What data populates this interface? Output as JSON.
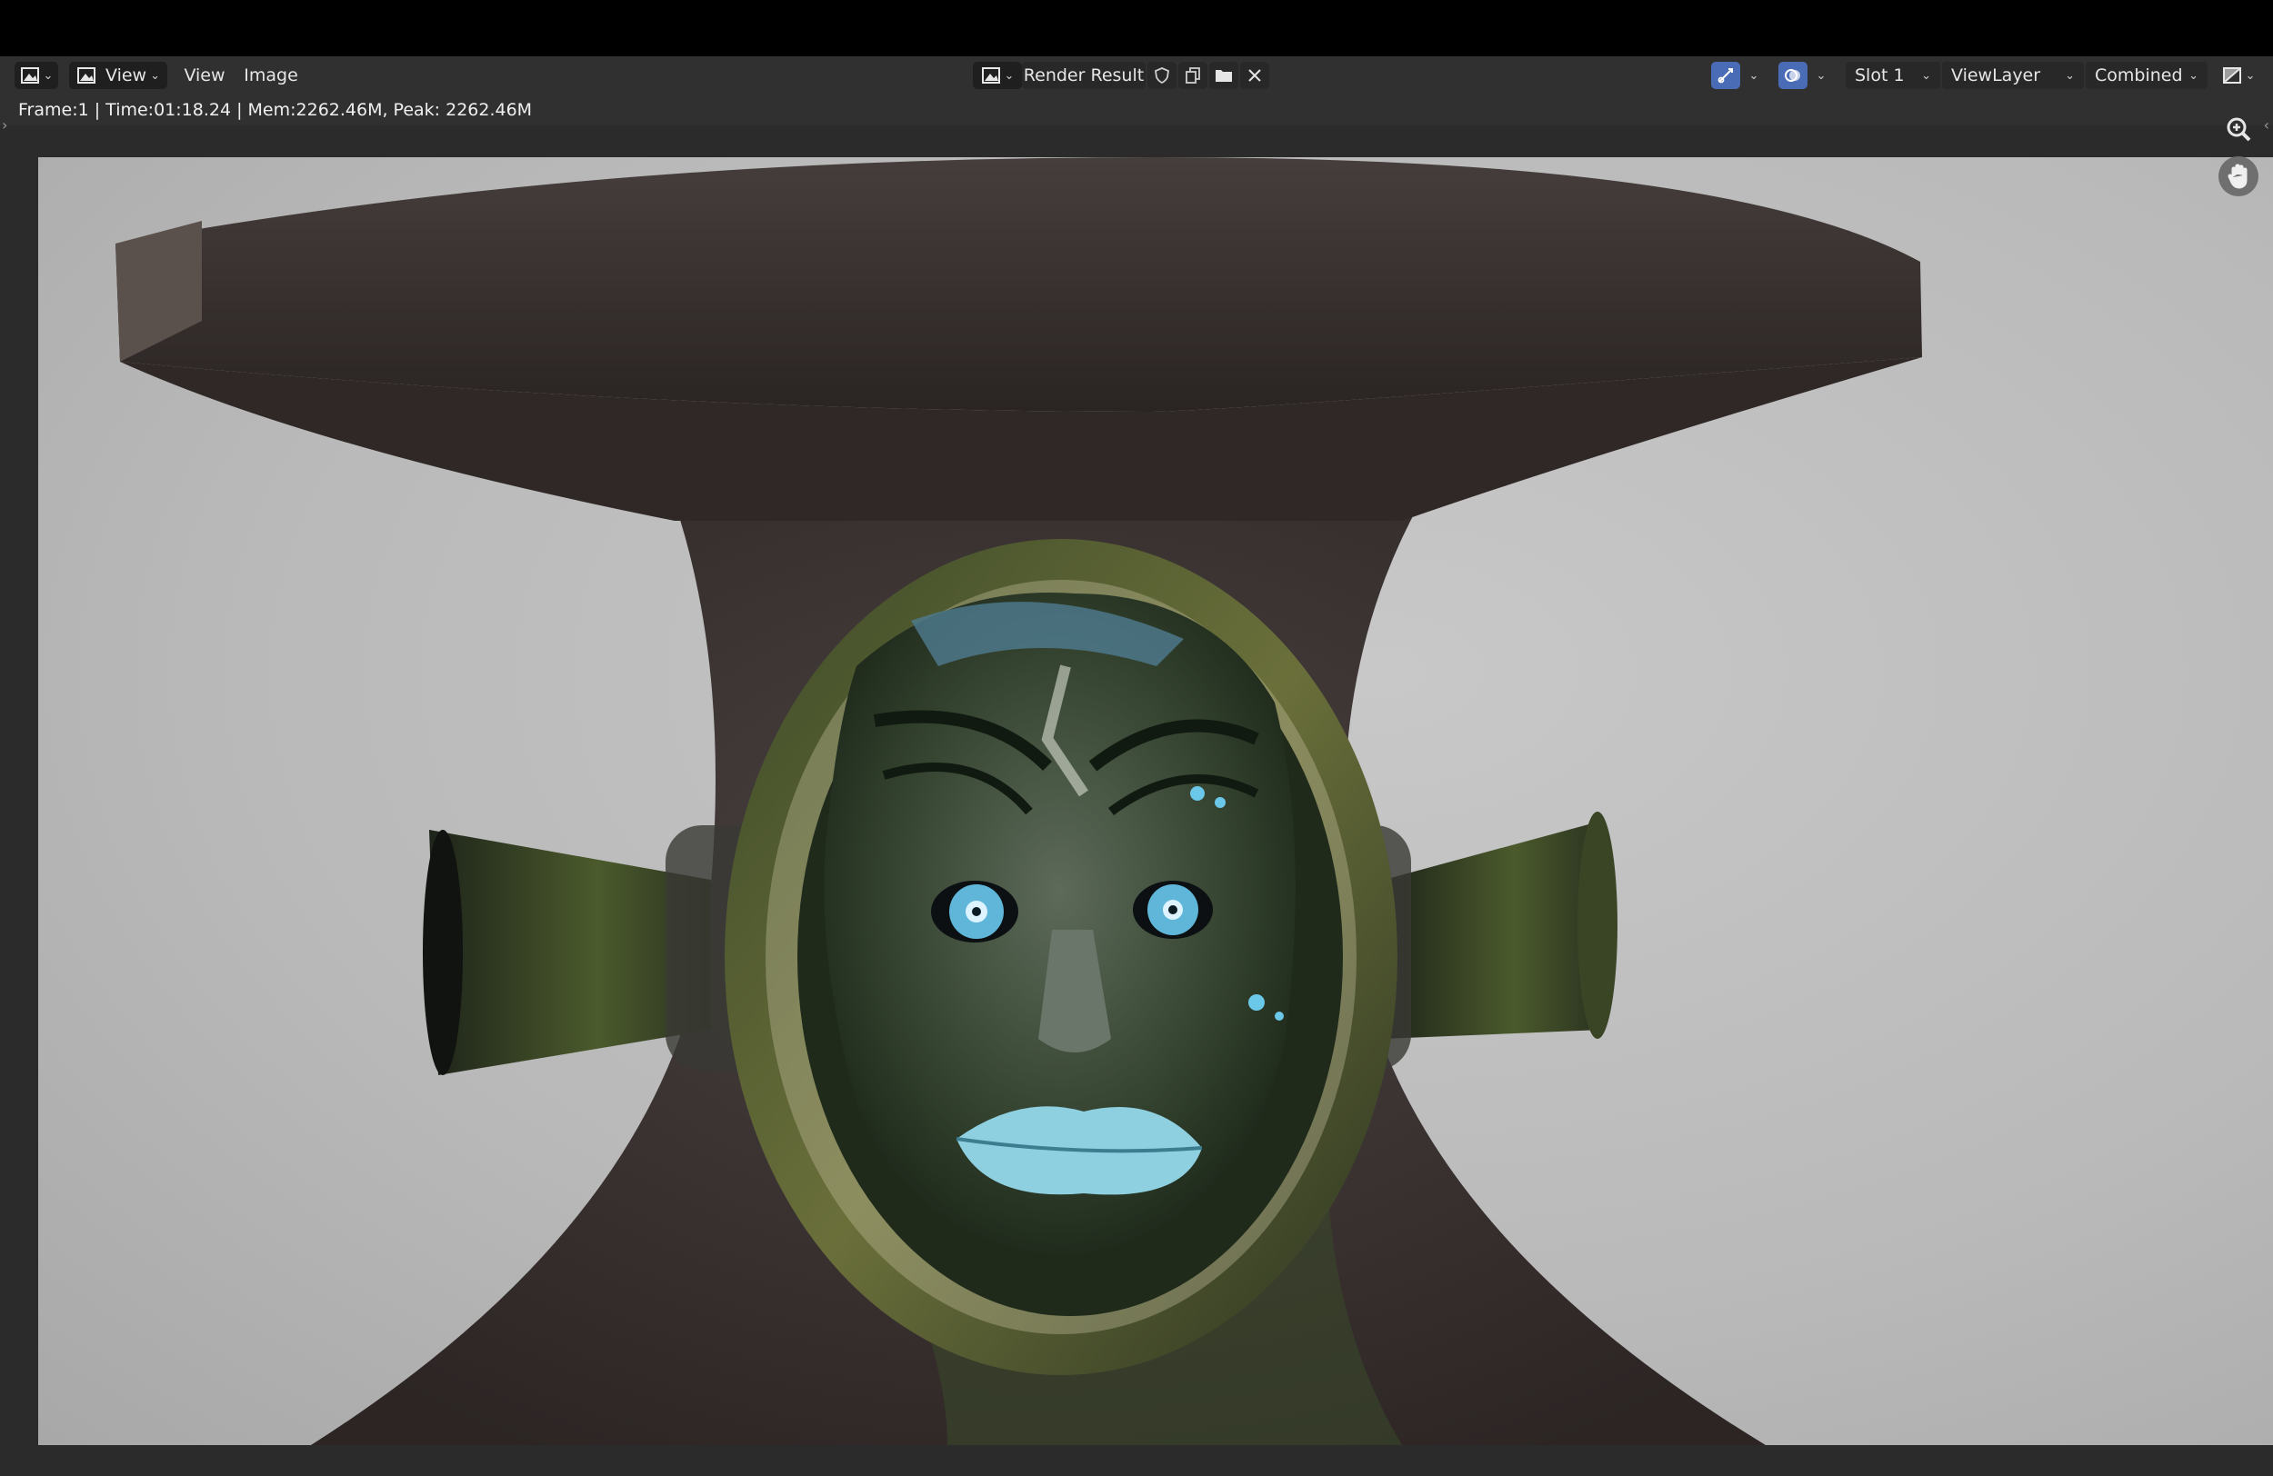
{
  "window": {
    "editor_type_icon": "image-editor-icon",
    "view_icon": "image-view-mode-icon"
  },
  "header": {
    "menu_view_1": "View",
    "menu_view_2": "View",
    "menu_image": "Image",
    "image_name": "Render Result",
    "slot": "Slot 1",
    "view_layer": "ViewLayer",
    "pass": "Combined"
  },
  "status": {
    "text": "Frame:1 | Time:01:18.24 | Mem:2262.46M, Peak: 2262.46M"
  },
  "colors": {
    "header_bg": "#303030",
    "accent_blue": "#4a6bb5",
    "render_bg": "#bdbdbd"
  },
  "icons": {
    "fake_user": "shield-icon",
    "new_image": "duplicate-icon",
    "open_image": "folder-icon",
    "unlink": "close-icon",
    "gizmo": "gizmo-icon",
    "overlay": "overlay-icon",
    "display_channels": "channels-icon",
    "zoom": "zoom-icon",
    "pan": "hand-icon"
  }
}
